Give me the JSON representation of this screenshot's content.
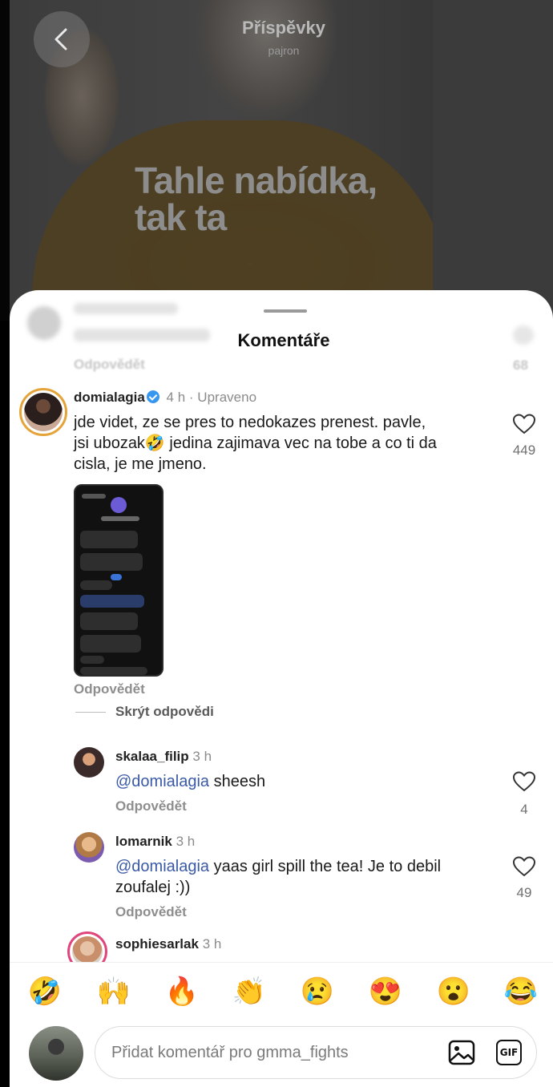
{
  "header": {
    "title": "Příspěvky",
    "subtitle": "pajron",
    "overlay_text_line1": "Tahle nabídka,",
    "overlay_text_line2": "tak ta"
  },
  "sheet": {
    "title": "Komentáře",
    "hidden_comment": {
      "reply_label": "Odpovědět",
      "likes": "68"
    }
  },
  "comments": [
    {
      "username": "domialagia",
      "verified": true,
      "time": "4 h",
      "edited": "· Upraveno",
      "text_line1": "jde videt, ze se pres to nedokazes prenest. pavle,",
      "text_line2": "jsi ubozak🤣 jedina zajimava vec na tobe a co ti da",
      "text_line3": "cisla, je me jmeno.",
      "likes": "449",
      "reply_label": "Odpovědět",
      "hide_replies_label": "Skrýt odpovědi"
    }
  ],
  "replies": [
    {
      "username": "skalaa_filip",
      "time": "3 h",
      "mention": "@domialagia",
      "text": " sheesh",
      "likes": "4",
      "reply_label": "Odpovědět"
    },
    {
      "username": "lomarnik",
      "time": "3 h",
      "mention": "@domialagia",
      "text": " yaas girl spill the tea! Je to debil",
      "text_line2": "zoufalej :))",
      "likes": "49",
      "reply_label": "Odpovědět"
    },
    {
      "username": "sophiesarlak",
      "time": "3 h"
    }
  ],
  "emoji_bar": [
    "🤣",
    "🙌",
    "🔥",
    "👏",
    "😢",
    "😍",
    "😮",
    "😂"
  ],
  "input": {
    "placeholder": "Přidat komentář pro gmma_fights",
    "gif_label": "GIF"
  },
  "colors": {
    "mention": "#3b5aa6",
    "verified": "#3797f0",
    "story_ring": "#e5a43a"
  },
  "icons": [
    "back-arrow-icon",
    "heart-icon",
    "image-icon",
    "gif-icon",
    "verified-badge-icon"
  ]
}
